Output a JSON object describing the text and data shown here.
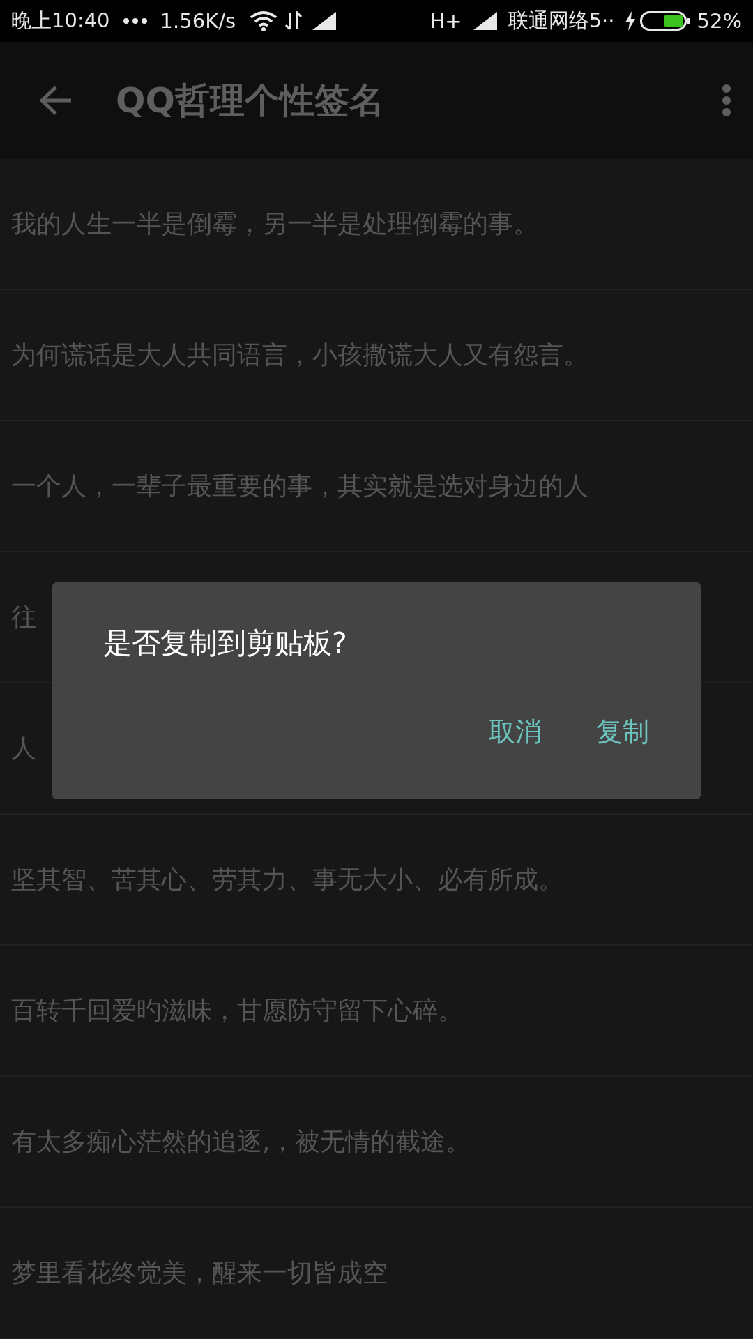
{
  "status_bar": {
    "time": "晚上10:40",
    "speed": "1.56K/s",
    "network_type": "H+",
    "carrier": "联通网络5··",
    "battery": "52%"
  },
  "app_bar": {
    "title": "QQ哲理个性签名"
  },
  "signatures": [
    {
      "text": "我的人生一半是倒霉，另一半是处理倒霉的事。"
    },
    {
      "text": "为何谎话是大人共同语言，小孩撒谎大人又有怨言。"
    },
    {
      "text": "一个人，一辈子最重要的事，其实就是选对身边的人"
    },
    {
      "text": "往"
    },
    {
      "text": "人"
    },
    {
      "text": "坚其智、苦其心、劳其力、事无大小、必有所成。"
    },
    {
      "text": "百转千回爱旳滋味，甘愿防守留下心碎。"
    },
    {
      "text": "有太多痴心茫然的追逐,，被无情的截途。"
    },
    {
      "text": "梦里看花终觉美，醒来一切皆成空"
    }
  ],
  "dialog": {
    "message": "是否复制到剪贴板?",
    "buttons": [
      "取消",
      "复制"
    ]
  }
}
